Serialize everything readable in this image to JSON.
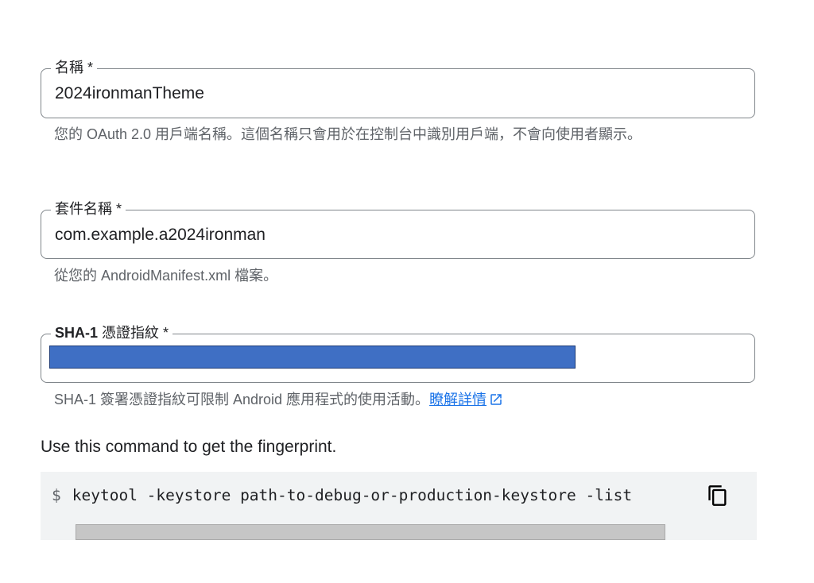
{
  "fields": {
    "name": {
      "label": "名稱 *",
      "value": "2024ironmanTheme",
      "helper": "您的 OAuth 2.0 用戶端名稱。這個名稱只會用於在控制台中識別用戶端，不會向使用者顯示。"
    },
    "package": {
      "label": "套件名稱 *",
      "value": "com.example.a2024ironman",
      "helper": "從您的 AndroidManifest.xml 檔案。"
    },
    "sha1": {
      "label_bold": "SHA-1",
      "label_rest": " 憑證指紋 *",
      "helper": "SHA-1 簽署憑證指紋可限制 Android 應用程式的使用活動。",
      "learn_more": "瞭解詳情"
    }
  },
  "command": {
    "intro": "Use this command to get the fingerprint.",
    "prompt": "$",
    "text": "keytool -keystore path-to-debug-or-production-keystore -list"
  },
  "icons": {
    "copy": "copy-icon",
    "external_link": "open-in-new-icon"
  },
  "colors": {
    "link": "#1a73e8",
    "redaction_blue": "#3f6fc4",
    "redaction_gray": "#c6c6c6",
    "code_bg": "#f1f3f4"
  }
}
